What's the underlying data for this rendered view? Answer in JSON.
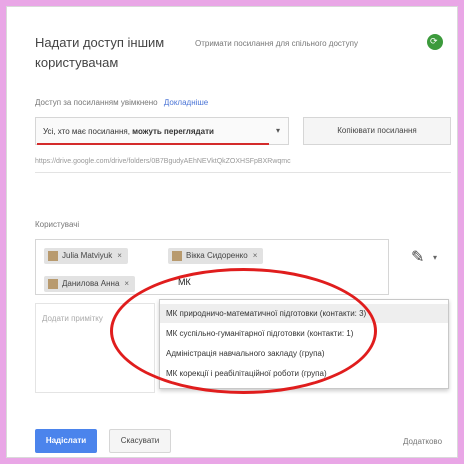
{
  "dialog": {
    "title": "Надати доступ іншим користувачам",
    "link_settings": "Отримати посилання для спільного доступу",
    "share_icon": "link-share-icon",
    "share_icon_color": "#3c9a3c"
  },
  "access": {
    "label": "Доступ за посиланням увімкнено",
    "detail": "Докладніше",
    "select_prefix": "Усі, хто має посилання,",
    "select_bold": "можуть переглядати",
    "caret": "▾",
    "copy_button": "Копіювати посилання",
    "link_url": "https://drive.google.com/drive/folders/0B7BgudyAEhNEVktQkZOXHSFpBXRwqmc"
  },
  "users": {
    "label": "Користувачі",
    "chips": [
      {
        "name": "Julia Matviyuk",
        "remove": "×"
      },
      {
        "name": "Вікка Сидоренко",
        "remove": "×"
      },
      {
        "name": "Данилова Анна",
        "remove": "×"
      }
    ],
    "typed_value": "МК",
    "pen_icon": "pencil-icon",
    "pen_glyph": "✎",
    "pen_caret": "▾"
  },
  "note": {
    "placeholder": "Додати примітку"
  },
  "suggestions": [
    "МК природничо-математичної підготовки (контакти: 3)",
    "МК суспільно-гуманітарної підготовки (контакти: 1)",
    "Адміністрація навчального закладу (група)",
    "МК корекції і реабілітаційної роботи (група)"
  ],
  "footer": {
    "ready": "Надіслати",
    "cancel": "Скасувати",
    "advanced": "Додатково"
  },
  "colors": {
    "accent": "#4b84ec",
    "annotation": "#e01d1d",
    "frame": "#e9a6e6"
  }
}
